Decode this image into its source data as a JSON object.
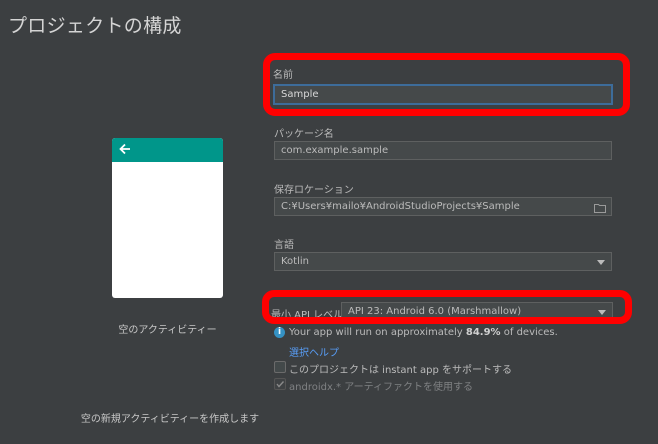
{
  "title": "プロジェクトの構成",
  "preview": {
    "activity_caption": "空のアクティビティー",
    "create_caption": "空の新規アクティビティーを作成します"
  },
  "name": {
    "label": "名前",
    "value": "Sample"
  },
  "package": {
    "label": "パッケージ名",
    "value": "com.example.sample"
  },
  "save_location": {
    "label": "保存ロケーション",
    "value": "C:¥Users¥mailo¥AndroidStudioProjects¥Sample"
  },
  "language": {
    "label": "言語",
    "value": "Kotlin"
  },
  "min_api": {
    "label": "最小 API レベル",
    "value": "API 23: Android 6.0 (Marshmallow)"
  },
  "coverage": {
    "prefix": "Your app will run on approximately ",
    "percent": "84.9%",
    "suffix": " of devices."
  },
  "help_link": "選択ヘルプ",
  "instant_app": {
    "label": "このプロジェクトは instant app をサポートする",
    "checked": false
  },
  "androidx": {
    "label": "androidx.* アーティファクトを使用する",
    "checked": true,
    "disabled": true
  },
  "colors": {
    "highlight": "#ff0000",
    "toolbar": "#00968a",
    "link": "#589df6",
    "background": "#3c3f41"
  },
  "icons": {
    "back": "arrow-left-icon",
    "folder": "folder-icon",
    "info": "info-icon"
  }
}
